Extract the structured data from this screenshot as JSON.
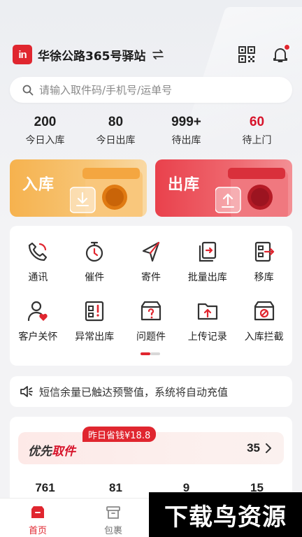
{
  "header": {
    "logo_text": "in",
    "station_name": "华徐公路365号驿站"
  },
  "search": {
    "placeholder": "请输入取件码/手机号/运单号"
  },
  "stats": [
    {
      "value": "200",
      "label": "今日入库"
    },
    {
      "value": "80",
      "label": "今日出库"
    },
    {
      "value": "999+",
      "label": "待出库"
    },
    {
      "value": "60",
      "label": "待上门"
    }
  ],
  "cards": {
    "in_label": "入库",
    "out_label": "出库"
  },
  "grid": [
    {
      "label": "通讯",
      "icon": "phone-icon"
    },
    {
      "label": "催件",
      "icon": "stopwatch-icon"
    },
    {
      "label": "寄件",
      "icon": "send-icon"
    },
    {
      "label": "批量出库",
      "icon": "batch-out-icon"
    },
    {
      "label": "移库",
      "icon": "move-stock-icon"
    },
    {
      "label": "客户关怀",
      "icon": "customer-care-icon"
    },
    {
      "label": "异常出库",
      "icon": "abnormal-out-icon"
    },
    {
      "label": "问题件",
      "icon": "problem-box-icon"
    },
    {
      "label": "上传记录",
      "icon": "upload-folder-icon"
    },
    {
      "label": "入库拦截",
      "icon": "intercept-box-icon"
    }
  ],
  "notice": {
    "text": "短信余量已触达预警值，系统将自动充值"
  },
  "priority": {
    "title_prefix": "优先",
    "title_accent": "取件",
    "badge": "昨日省钱¥18.8",
    "count": "35",
    "stats": [
      "761",
      "81",
      "9",
      "15"
    ]
  },
  "tabbar": [
    {
      "label": "首页",
      "active": true
    },
    {
      "label": "包裹",
      "active": false
    }
  ],
  "watermark": "下载鸟资源",
  "colors": {
    "brand_red": "#e0262f",
    "accent_red": "#d7132a",
    "in_card": "#f6b24e",
    "out_card": "#e9414c"
  }
}
